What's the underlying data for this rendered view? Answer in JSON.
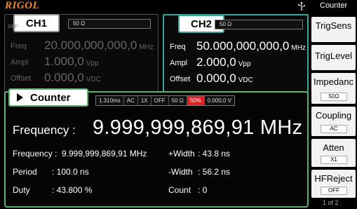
{
  "header": {
    "brand": "RIGOL",
    "mode": "Counter",
    "usb_icon": "usb-icon"
  },
  "ch1": {
    "name": "CH1",
    "state": "OFF",
    "impedance": "50 Ω",
    "freq_label": "Freq",
    "freq_value": "20.000,000,000,0",
    "freq_unit": "MHz",
    "ampl_label": "Ampl",
    "ampl_value": "1.000,0",
    "ampl_unit": "Vpp",
    "offset_label": "Offset",
    "offset_value": "0.000,0",
    "offset_unit": "VDC"
  },
  "ch2": {
    "name": "CH2",
    "state": "OFF",
    "impedance": "50 Ω",
    "freq_label": "Freq",
    "freq_value": "50.000,000,000,0",
    "freq_unit": "MHz",
    "ampl_label": "Ampl",
    "ampl_value": "2.000,0",
    "ampl_unit": "Vpp",
    "offset_label": "Offset",
    "offset_value": "0.000,0",
    "offset_unit": "VDC"
  },
  "counter": {
    "title": "Counter",
    "settings": [
      "1.310ms",
      "AC",
      "1X",
      "OFF",
      "50 Ω",
      "50%",
      "0.000,0 V"
    ],
    "big_label": "Frequency :",
    "big_value": "9.999,999,869,91 MHz",
    "stats": {
      "frequency_label": "Frequency :",
      "frequency_value": "9.999,999,869,91 MHz",
      "period_label": "Period",
      "period_value": ": 100.0 ns",
      "duty_label": "Duty",
      "duty_value": ": 43.800 %",
      "pwidth_label": "+Width",
      "pwidth_value": ":   43.8 ns",
      "nwidth_label": "-Width",
      "nwidth_value": ":   56.2 ns",
      "count_label": "Count",
      "count_value": ":   0"
    },
    "highlight_color": "#e11f24"
  },
  "menu": {
    "items": [
      {
        "label": "TrigSens",
        "sub": ""
      },
      {
        "label": "TrigLevel",
        "sub": ""
      },
      {
        "label": "Impedanc",
        "sub": "50Ω"
      },
      {
        "label": "Coupling",
        "sub": "AC"
      },
      {
        "label": "Atten",
        "sub": "X1"
      },
      {
        "label": "HFReject",
        "sub": "OFF"
      }
    ],
    "page": "1 of 2"
  },
  "colors": {
    "brand": "#f08a1c",
    "ch2_border": "#3aa59d",
    "counter_border": "#5fb36d"
  }
}
